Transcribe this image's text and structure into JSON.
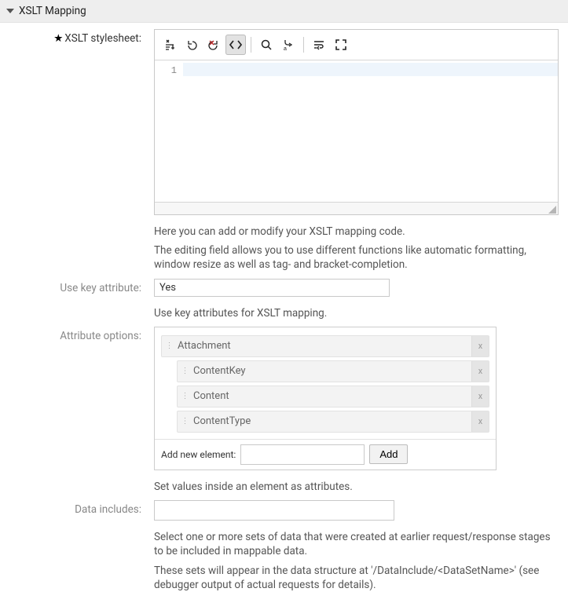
{
  "header": {
    "title": "XSLT Mapping"
  },
  "xslt": {
    "label": "XSLT stylesheet:",
    "gutter": "1",
    "help1": "Here you can add or modify your XSLT mapping code.",
    "help2": "The editing field allows you to use different functions like automatic formatting, window resize as well as tag- and bracket-completion."
  },
  "useKey": {
    "label": "Use key attribute:",
    "value": "Yes",
    "help": "Use key attributes for XSLT mapping."
  },
  "attrOpts": {
    "label": "Attribute options:",
    "items": [
      {
        "label": "Attachment",
        "indent": false
      },
      {
        "label": "ContentKey",
        "indent": true
      },
      {
        "label": "Content",
        "indent": true
      },
      {
        "label": "ContentType",
        "indent": true
      }
    ],
    "addLabel": "Add new element:",
    "addButton": "Add",
    "help": "Set values inside an element as attributes."
  },
  "dataIncludes": {
    "label": "Data includes:",
    "help1": "Select one or more sets of data that were created at earlier request/response stages to be included in mappable data.",
    "help2": "These sets will appear in the data structure at '/DataInclude/<DataSetName>' (see debugger output of actual requests for details)."
  }
}
